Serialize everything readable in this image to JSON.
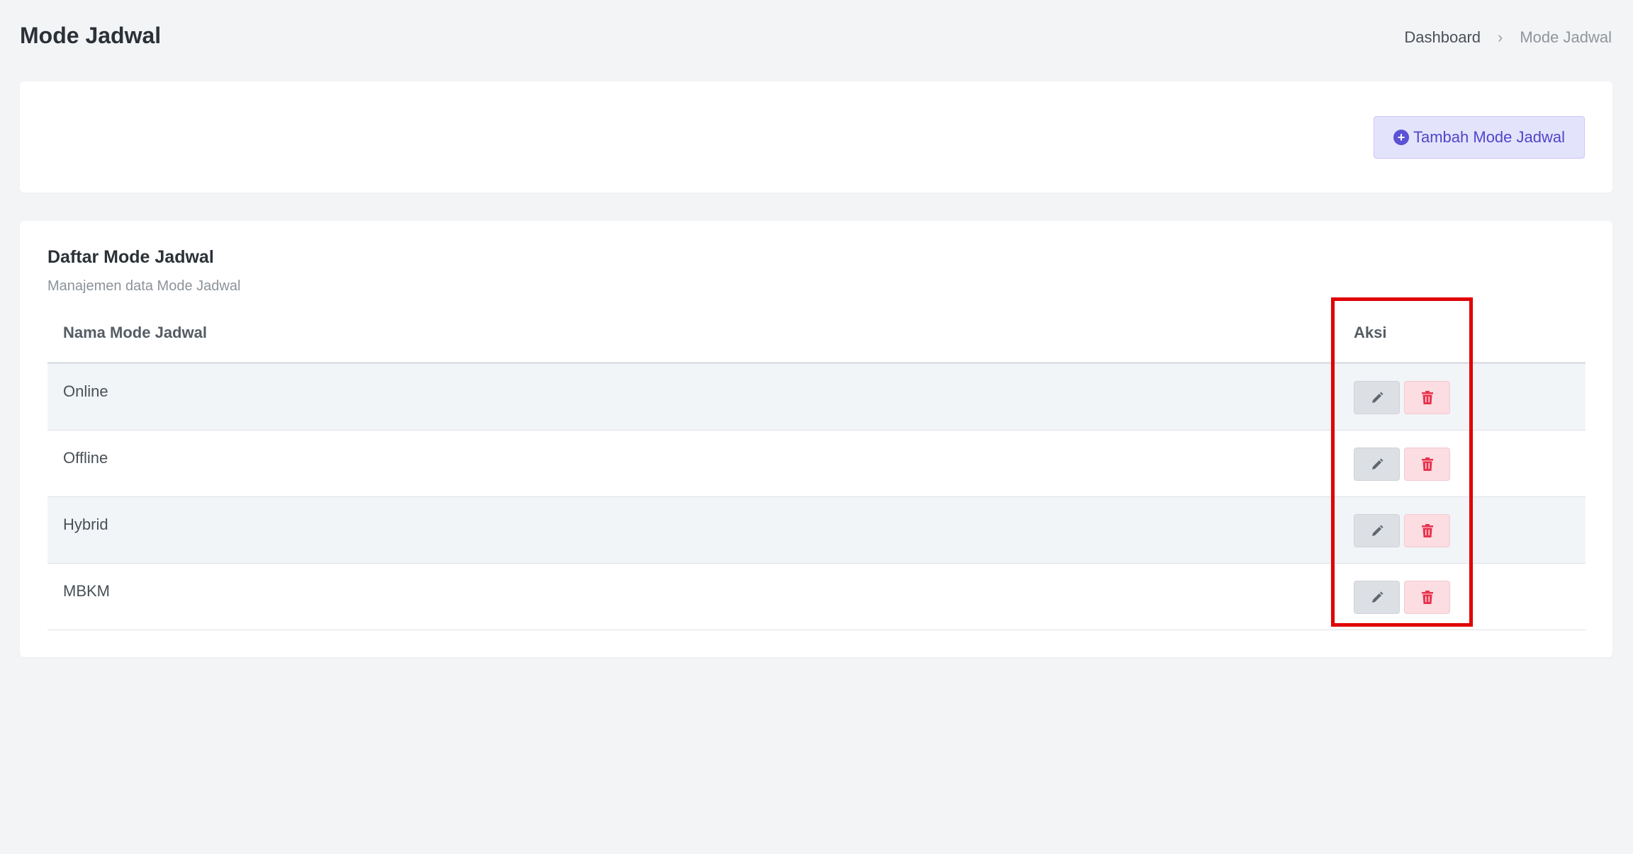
{
  "header": {
    "title": "Mode Jadwal",
    "breadcrumb": {
      "parent": "Dashboard",
      "separator": "›",
      "current": "Mode Jadwal"
    }
  },
  "toolbar": {
    "add_label": "Tambah Mode Jadwal",
    "add_icon": "plus-circle-icon"
  },
  "list": {
    "title": "Daftar Mode Jadwal",
    "subtitle": "Manajemen data Mode Jadwal",
    "columns": [
      "Nama Mode Jadwal",
      "Aksi"
    ],
    "rows": [
      {
        "name": "Online"
      },
      {
        "name": "Offline"
      },
      {
        "name": "Hybrid"
      },
      {
        "name": "MBKM"
      }
    ],
    "row_actions": [
      "pencil-icon",
      "trash-icon"
    ]
  },
  "colors": {
    "accent": "#5b52d6",
    "danger": "#e8344e",
    "highlight": "#e00000"
  }
}
